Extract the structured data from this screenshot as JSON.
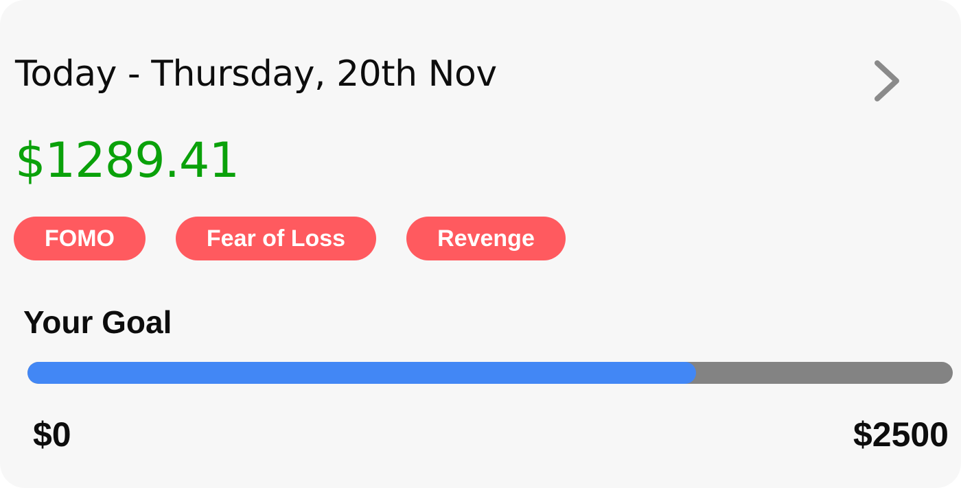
{
  "header": {
    "date_title": "Today - Thursday, 20th Nov",
    "next_icon": "chevron-right-icon"
  },
  "summary": {
    "amount": "$1289.41"
  },
  "tags": [
    {
      "label": "FOMO"
    },
    {
      "label": "Fear of Loss"
    },
    {
      "label": "Revenge"
    }
  ],
  "goal": {
    "title": "Your Goal",
    "min_label": "$0",
    "max_label": "$2500",
    "progress_fraction": 0.7226
  },
  "colors": {
    "card_background": "#f7f7f7",
    "amount_text": "#0aa10a",
    "tag_background": "#ff5a5f",
    "tag_text": "#ffffff",
    "progress_fill": "#4287f5",
    "progress_track": "#838383",
    "chevron": "#8a8a8a"
  }
}
